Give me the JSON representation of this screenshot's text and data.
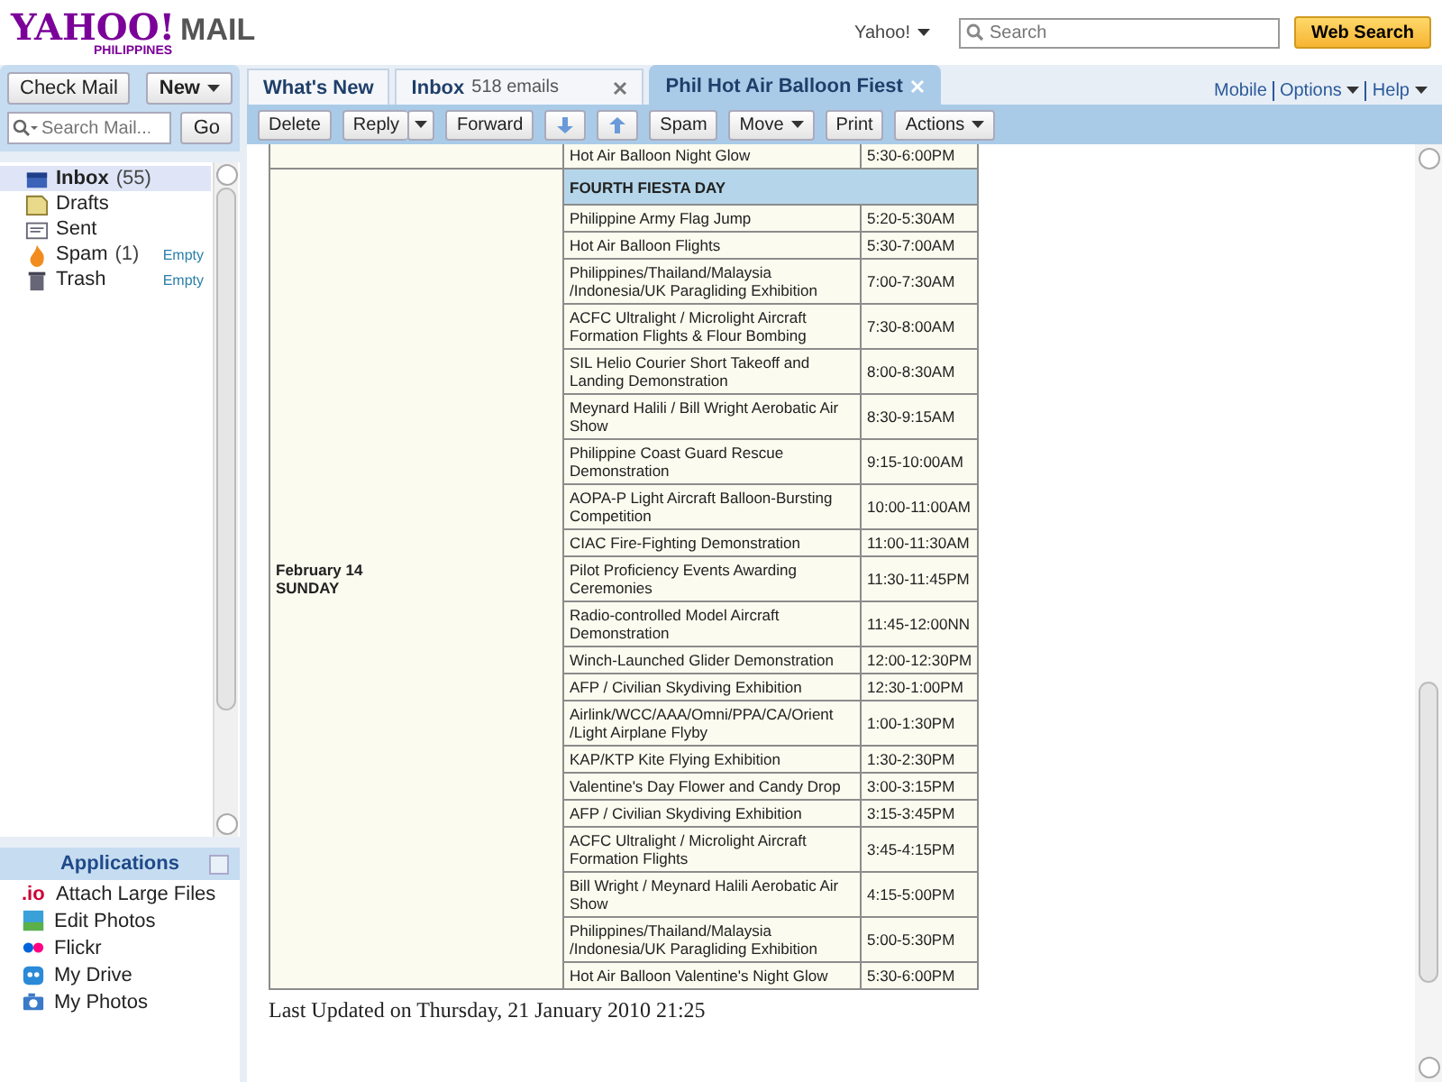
{
  "header": {
    "logo": "YAHOO!",
    "logo_suffix": "MAIL",
    "logo_region": "PHILIPPINES",
    "search_scope": "Yahoo!",
    "search_placeholder": "Search",
    "search_button": "Web Search"
  },
  "left": {
    "check_mail": "Check Mail",
    "new_button": "New",
    "search_placeholder": "Search Mail...",
    "go_button": "Go",
    "folders": [
      {
        "name": "Inbox",
        "count": "(55)",
        "selected": true
      },
      {
        "name": "Drafts",
        "selected": false
      },
      {
        "name": "Sent",
        "selected": false
      },
      {
        "name": "Spam",
        "count": "(1)",
        "action": "Empty",
        "selected": false
      },
      {
        "name": "Trash",
        "action": "Empty",
        "selected": false
      }
    ],
    "applications": {
      "title": "Applications",
      "items": [
        {
          "label": "Attach Large Files",
          "icon_text": ".io"
        },
        {
          "label": "Edit Photos"
        },
        {
          "label": "Flickr"
        },
        {
          "label": "My Drive"
        },
        {
          "label": "My Photos"
        }
      ]
    }
  },
  "tabs": [
    {
      "label": "What's New",
      "selected": false
    },
    {
      "label": "Inbox",
      "note": "518 emails",
      "closable": true,
      "selected": false
    },
    {
      "label": "Phil Hot Air Balloon Fiest",
      "closable": true,
      "selected": true
    }
  ],
  "top_links": [
    "Mobile",
    "Options",
    "Help"
  ],
  "toolbar": [
    {
      "label": "Delete",
      "kind": "button"
    },
    {
      "label": "Reply",
      "kind": "split"
    },
    {
      "label": "Forward",
      "kind": "button"
    },
    {
      "kind": "down"
    },
    {
      "kind": "up"
    },
    {
      "label": "Spam",
      "kind": "button"
    },
    {
      "label": "Move",
      "kind": "menu"
    },
    {
      "label": "Print",
      "kind": "button"
    },
    {
      "label": "Actions",
      "kind": "menu"
    }
  ],
  "schedule": {
    "previous_rows": [
      {
        "event": "Hot Air Balloon Night Glow",
        "time": "5:30-6:00PM"
      }
    ],
    "day_heading": "FOURTH FIESTA DAY",
    "date": "February 14",
    "weekday": "SUNDAY",
    "rows": [
      {
        "event": "Philippine Army Flag Jump",
        "time": "5:20-5:30AM"
      },
      {
        "event": "Hot Air Balloon Flights",
        "time": "5:30-7:00AM"
      },
      {
        "event": "Philippines/Thailand/Malaysia /Indonesia/UK Paragliding Exhibition",
        "time": "7:00-7:30AM"
      },
      {
        "event": "ACFC Ultralight / Microlight Aircraft Formation Flights & Flour Bombing",
        "time": "7:30-8:00AM"
      },
      {
        "event": "SIL Helio Courier Short Takeoff and Landing Demonstration",
        "time": "8:00-8:30AM"
      },
      {
        "event": "Meynard Halili / Bill Wright Aerobatic Air Show",
        "time": "8:30-9:15AM"
      },
      {
        "event": "Philippine Coast Guard Rescue Demonstration",
        "time": "9:15-10:00AM"
      },
      {
        "event": "AOPA-P Light Aircraft Balloon-Bursting Competition",
        "time": "10:00-11:00AM"
      },
      {
        "event": "CIAC Fire-Fighting Demonstration",
        "time": "11:00-11:30AM"
      },
      {
        "event": "Pilot Proficiency Events Awarding Ceremonies",
        "time": "11:30-11:45PM"
      },
      {
        "event": "Radio-controlled Model Aircraft Demonstration",
        "time": "11:45-12:00NN"
      },
      {
        "event": "Winch-Launched Glider Demonstration",
        "time": "12:00-12:30PM"
      },
      {
        "event": "AFP / Civilian Skydiving Exhibition",
        "time": "12:30-1:00PM"
      },
      {
        "event": "Airlink/WCC/AAA/Omni/PPA/CA/Orient /Light Airplane Flyby",
        "time": "1:00-1:30PM"
      },
      {
        "event": "KAP/KTP Kite Flying Exhibition",
        "time": "1:30-2:30PM"
      },
      {
        "event": "Valentine's Day Flower and Candy Drop",
        "time": "3:00-3:15PM"
      },
      {
        "event": "AFP / Civilian Skydiving Exhibition",
        "time": "3:15-3:45PM"
      },
      {
        "event": "ACFC Ultralight / Microlight Aircraft Formation Flights",
        "time": "3:45-4:15PM"
      },
      {
        "event": "Bill Wright / Meynard Halili Aerobatic Air Show",
        "time": "4:15-5:00PM"
      },
      {
        "event": "Philippines/Thailand/Malaysia /Indonesia/UK Paragliding Exhibition",
        "time": "5:00-5:30PM"
      },
      {
        "event": "Hot Air Balloon Valentine's Night Glow",
        "time": "5:30-6:00PM"
      }
    ],
    "footer": "Last Updated on Thursday, 21 January 2010 21:25"
  }
}
